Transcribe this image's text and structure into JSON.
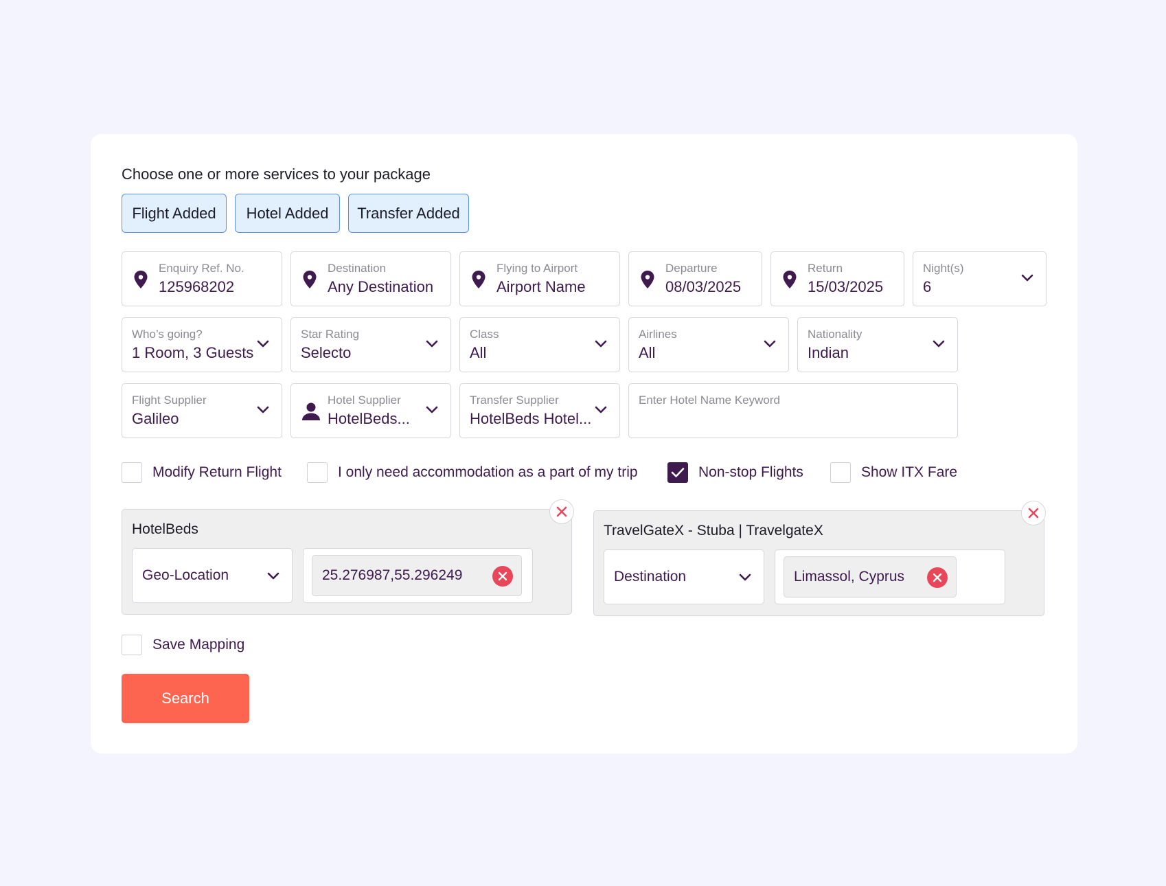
{
  "heading": "Choose one or more services to your package",
  "services": [
    "Flight Added",
    "Hotel Added",
    "Transfer Added"
  ],
  "row1": [
    {
      "label": "Enquiry Ref. No.",
      "value": "125968202",
      "icon": "location-pin-icon"
    },
    {
      "label": "Destination",
      "value": "Any Destination",
      "icon": "location-pin-icon"
    },
    {
      "label": "Flying to Airport",
      "value": "Airport Name",
      "icon": "location-pin-icon"
    },
    {
      "label": "Departure",
      "value": "08/03/2025",
      "icon": "location-pin-icon"
    },
    {
      "label": "Return",
      "value": "15/03/2025",
      "icon": "location-pin-icon"
    },
    {
      "label": "Night(s)",
      "value": "6",
      "icon": "chevron-down-icon"
    }
  ],
  "row2": [
    {
      "label": "Who’s going?",
      "value": "1 Room, 3 Guests"
    },
    {
      "label": "Star Rating",
      "value": "Selecto"
    },
    {
      "label": "Class",
      "value": "All"
    },
    {
      "label": "Airlines",
      "value": "All"
    },
    {
      "label": "Nationality",
      "value": "Indian"
    }
  ],
  "row3": {
    "flight_supplier": {
      "label": "Flight Supplier",
      "value": "Galileo"
    },
    "hotel_supplier": {
      "label": "Hotel Supplier",
      "value": "HotelBeds...",
      "icon": "person-icon"
    },
    "transfer_supplier": {
      "label": "Transfer Supplier",
      "value": "HotelBeds Hotel..."
    },
    "hotel_keyword": {
      "placeholder": "Enter Hotel Name Keyword"
    }
  },
  "options": [
    {
      "label": "Modify Return Flight",
      "checked": false
    },
    {
      "label": "I only need accommodation as a part of my trip",
      "checked": false
    },
    {
      "label": "Non-stop Flights",
      "checked": true
    },
    {
      "label": "Show ITX Fare",
      "checked": false
    }
  ],
  "mappings": [
    {
      "title": "HotelBeds",
      "type": "Geo-Location",
      "chip": "25.276987,55.296249"
    },
    {
      "title": "TravelGateX - Stuba | TravelgateX",
      "type": "Destination",
      "chip": "Limassol, Cyprus"
    }
  ],
  "save_mapping": {
    "label": "Save Mapping",
    "checked": false
  },
  "search_label": "Search",
  "colors": {
    "background": "#f3f4fd",
    "accent_purple": "#3e1a4e",
    "service_chip_bg": "#e2effd",
    "service_chip_border": "#5b93e0",
    "search_button": "#fe6551",
    "remove_red": "#e8475a"
  }
}
